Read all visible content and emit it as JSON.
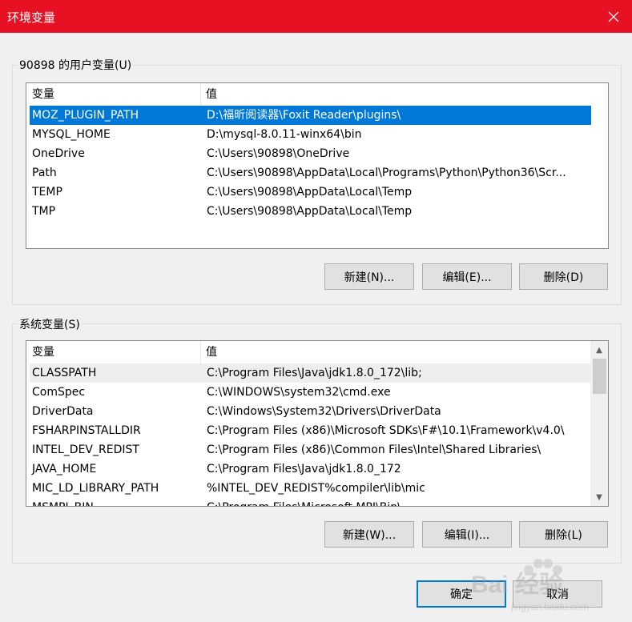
{
  "window": {
    "title": "环境变量",
    "close_icon": "close-icon"
  },
  "user_vars": {
    "group_label": "90898 的用户变量(U)",
    "col_variable": "变量",
    "col_value": "值",
    "rows": [
      {
        "name": "MOZ_PLUGIN_PATH",
        "value": "D:\\福昕阅读器\\Foxit Reader\\plugins\\"
      },
      {
        "name": "MYSQL_HOME",
        "value": "D:\\mysql-8.0.11-winx64\\bin"
      },
      {
        "name": "OneDrive",
        "value": "C:\\Users\\90898\\OneDrive"
      },
      {
        "name": "Path",
        "value": "C:\\Users\\90898\\AppData\\Local\\Programs\\Python\\Python36\\Scr..."
      },
      {
        "name": "TEMP",
        "value": "C:\\Users\\90898\\AppData\\Local\\Temp"
      },
      {
        "name": "TMP",
        "value": "C:\\Users\\90898\\AppData\\Local\\Temp"
      }
    ],
    "new_label": "新建(N)...",
    "edit_label": "编辑(E)...",
    "delete_label": "删除(D)"
  },
  "system_vars": {
    "group_label": "系统变量(S)",
    "col_variable": "变量",
    "col_value": "值",
    "rows": [
      {
        "name": "CLASSPATH",
        "value": "C:\\Program Files\\Java\\jdk1.8.0_172\\lib;"
      },
      {
        "name": "ComSpec",
        "value": "C:\\WINDOWS\\system32\\cmd.exe"
      },
      {
        "name": "DriverData",
        "value": "C:\\Windows\\System32\\Drivers\\DriverData"
      },
      {
        "name": "FSHARPINSTALLDIR",
        "value": "C:\\Program Files (x86)\\Microsoft SDKs\\F#\\10.1\\Framework\\v4.0\\"
      },
      {
        "name": "INTEL_DEV_REDIST",
        "value": "C:\\Program Files (x86)\\Common Files\\Intel\\Shared Libraries\\"
      },
      {
        "name": "JAVA_HOME",
        "value": "C:\\Program Files\\Java\\jdk1.8.0_172"
      },
      {
        "name": "MIC_LD_LIBRARY_PATH",
        "value": "%INTEL_DEV_REDIST%compiler\\lib\\mic"
      },
      {
        "name": "MSMPI_BIN",
        "value": "C:\\Program Files\\Microsoft MPI\\Bin\\"
      }
    ],
    "new_label": "新建(W)...",
    "edit_label": "编辑(I)...",
    "delete_label": "删除(L)"
  },
  "footer": {
    "ok_label": "确定",
    "cancel_label": "取消"
  },
  "watermark": {
    "brand": "Bai 经验",
    "url": "jingyan.baidu.com"
  },
  "colors": {
    "titlebar": "#e81123",
    "selection": "#0078d7"
  }
}
